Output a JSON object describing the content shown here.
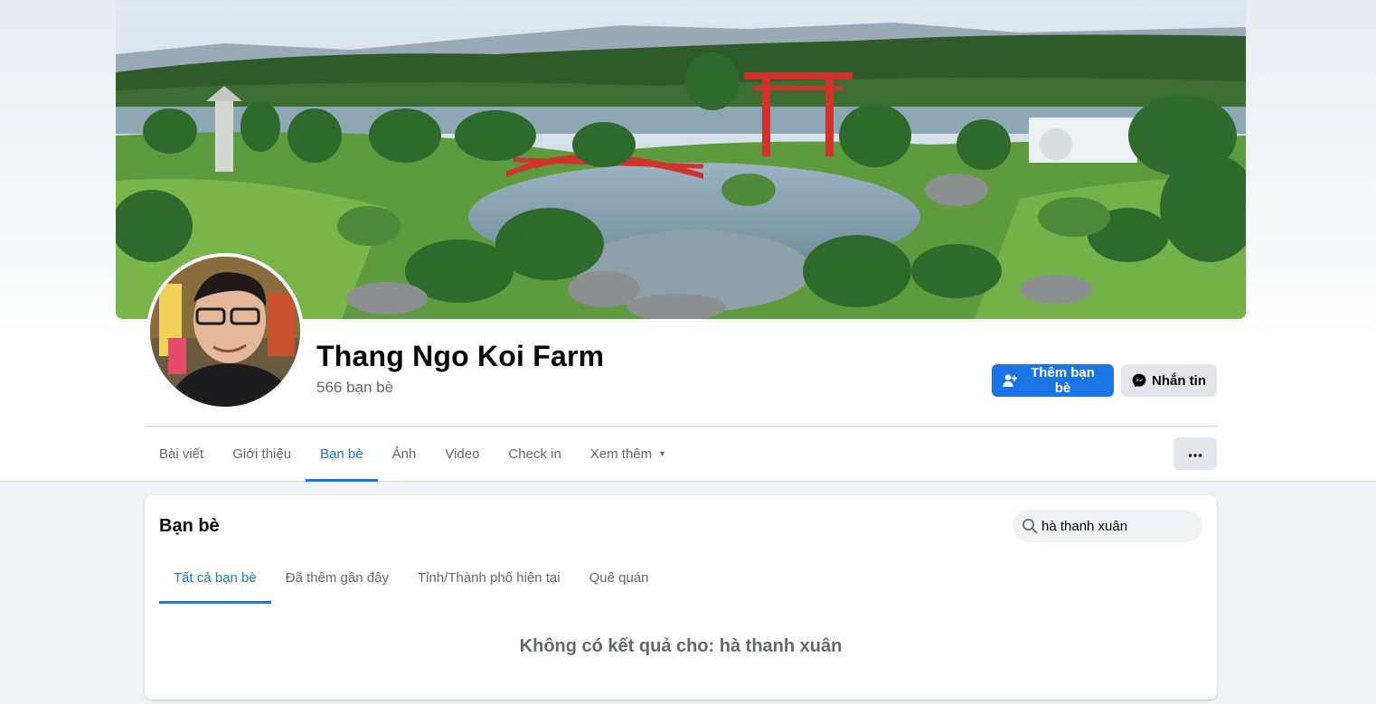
{
  "profile": {
    "name": "Thang Ngo Koi Farm",
    "friend_count": "566 bạn bè"
  },
  "actions": {
    "add_friend": "Thêm bạn bè",
    "message": "Nhắn tin"
  },
  "nav": {
    "tabs": [
      {
        "label": "Bài viết"
      },
      {
        "label": "Giới thiệu"
      },
      {
        "label": "Bạn bè",
        "active": true
      },
      {
        "label": "Ảnh"
      },
      {
        "label": "Video"
      },
      {
        "label": "Check in"
      },
      {
        "label": "Xem thêm"
      }
    ],
    "more_icon": "ellipsis-icon"
  },
  "friends": {
    "title": "Bạn bè",
    "search": {
      "value": "hà thanh xuân"
    },
    "subtabs": [
      {
        "label": "Tất cả bạn bè",
        "active": true
      },
      {
        "label": "Đã thêm gần đây"
      },
      {
        "label": "Tỉnh/Thành phố hiện tại"
      },
      {
        "label": "Quê quán"
      }
    ],
    "empty_message": "Không có kết quả cho: hà thanh xuân"
  },
  "colors": {
    "accent": "#1b74e4",
    "secondary_text": "#65676b",
    "button_gray": "#e4e6eb",
    "page_bg": "#f0f2f5"
  }
}
